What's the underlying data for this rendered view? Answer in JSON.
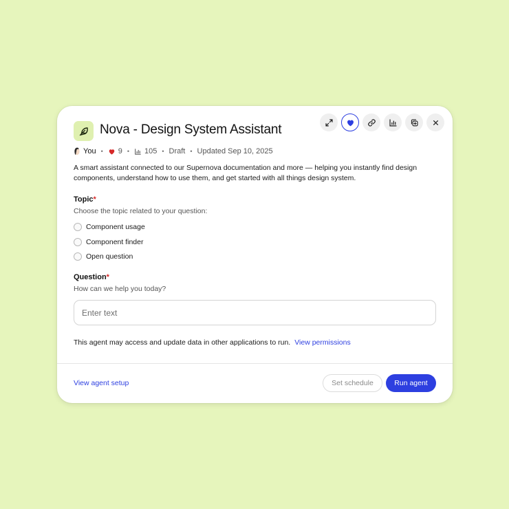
{
  "header": {
    "title": "Nova - Design System Assistant",
    "app_icon": "feather-icon",
    "toolbar": [
      {
        "name": "expand-icon"
      },
      {
        "name": "heart-icon"
      },
      {
        "name": "link-icon"
      },
      {
        "name": "bar-chart-icon"
      },
      {
        "name": "duplicate-icon"
      },
      {
        "name": "close-icon"
      }
    ]
  },
  "meta": {
    "author": "You",
    "likes": "9",
    "views": "105",
    "status": "Draft",
    "updated": "Updated Sep 10, 2025",
    "separator": "•"
  },
  "description": "A smart assistant connected to our Supernova documentation and more — helping you instantly find design components, understand how to use them, and get started with all things design system.",
  "topic": {
    "label": "Topic",
    "required_mark": "*",
    "help": "Choose the topic related to your question:",
    "options": [
      "Component usage",
      "Component finder",
      "Open question"
    ]
  },
  "question": {
    "label": "Question",
    "required_mark": "*",
    "help": "How can we help you today?",
    "placeholder": "Enter text",
    "value": ""
  },
  "permissions": {
    "text": "This agent may access and update data in other applications to run.",
    "link": "View permissions"
  },
  "footer": {
    "setup_link": "View agent setup",
    "schedule_label": "Set schedule",
    "run_label": "Run agent"
  },
  "colors": {
    "background": "#e6f5bc",
    "accent": "#2d3fe0",
    "required": "#d62828",
    "heart": "#d62828"
  }
}
